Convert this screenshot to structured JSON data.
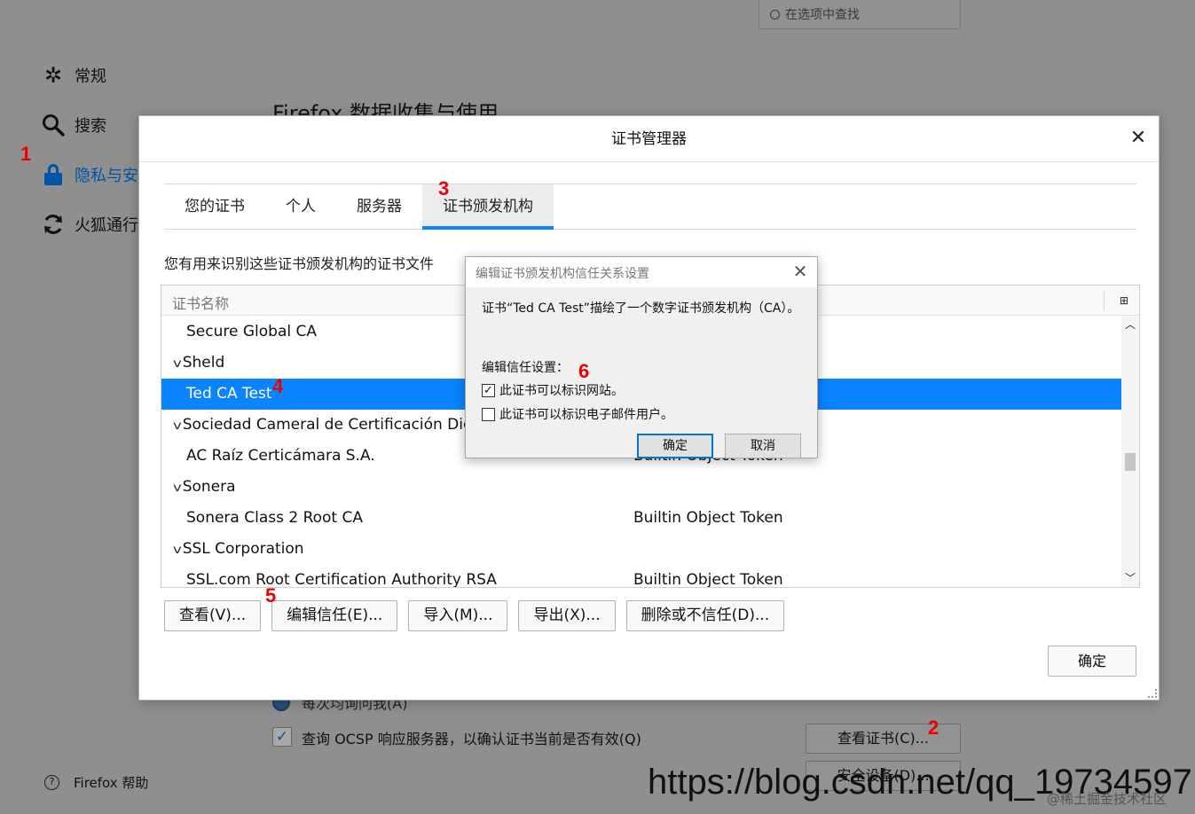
{
  "background": {
    "search_placeholder": "在选项中查找",
    "nav": [
      {
        "label": "常规",
        "icon": "gear-icon"
      },
      {
        "label": "搜索",
        "icon": "search-icon"
      },
      {
        "label": "隐私与安",
        "icon": "lock-icon",
        "active": true
      },
      {
        "label": "火狐通行",
        "icon": "sync-icon"
      }
    ],
    "heading": "Firefox 数据收集与使用",
    "radio_label": "每次均询问我(A)",
    "ocsp_label": "查询 OCSP 响应服务器，以确认证书当前是否有效(Q)",
    "view_certs_button": "查看证书(C)...",
    "security_devices_button": "安全设备(D)...",
    "help": "Firefox 帮助"
  },
  "annotations": [
    "1",
    "2",
    "3",
    "4",
    "5",
    "6"
  ],
  "cert_manager": {
    "title": "证书管理器",
    "tabs": [
      "您的证书",
      "个人",
      "服务器",
      "证书颁发机构"
    ],
    "selected_tab": "证书颁发机构",
    "description": "您有用来识别这些证书颁发机构的证书文件",
    "column_name": "证书名称",
    "rows": [
      {
        "name": "Secure Global CA",
        "token": "",
        "type": "child"
      },
      {
        "name": "Sheld",
        "token": "",
        "type": "group"
      },
      {
        "name": "Ted CA Test",
        "token": "",
        "type": "child",
        "selected": true
      },
      {
        "name": "Sociedad Cameral de Certificación Digit",
        "token": "",
        "type": "group"
      },
      {
        "name": "AC Raíz Certicámara S.A.",
        "token": "Builtin Object Token",
        "type": "child"
      },
      {
        "name": "Sonera",
        "token": "",
        "type": "group"
      },
      {
        "name": "Sonera Class 2 Root CA",
        "token": "Builtin Object Token",
        "type": "child"
      },
      {
        "name": "SSL Corporation",
        "token": "",
        "type": "group"
      },
      {
        "name": "SSL.com Root Certification Authority RSA",
        "token": "Builtin Object Token",
        "type": "child"
      }
    ],
    "buttons": [
      "查看(V)...",
      "编辑信任(E)...",
      "导入(M)...",
      "导出(X)...",
      "删除或不信任(D)..."
    ],
    "ok": "确定"
  },
  "edit_trust": {
    "title": "编辑证书颁发机构信任关系设置",
    "message": "证书“Ted CA Test”描绘了一个数字证书颁发机构（CA）。",
    "subheading": "编辑信任设置：",
    "checkbox_websites": "此证书可以标识网站。",
    "checkbox_websites_checked": true,
    "checkbox_email": "此证书可以标识电子邮件用户。",
    "checkbox_email_checked": false,
    "ok": "确定",
    "cancel": "取消"
  },
  "watermark": "https://blog.csdn.net/qq_19734597",
  "watermark_small": "@稀土掘金技术社区"
}
